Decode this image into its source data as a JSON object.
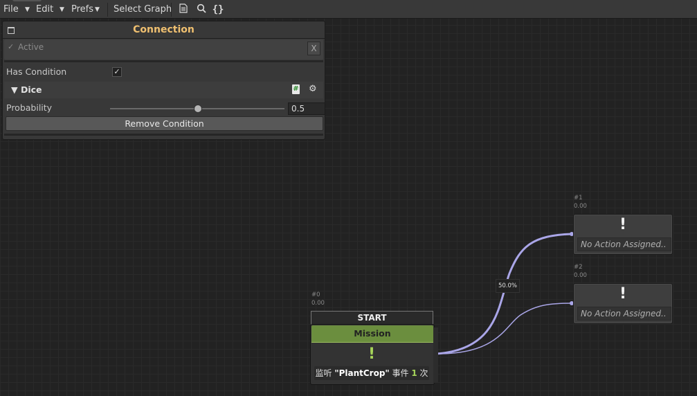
{
  "toolbar": {
    "file": "File",
    "edit": "Edit",
    "prefs": "Prefs",
    "select_graph": "Select Graph",
    "icons": [
      "document-icon",
      "search-icon",
      "braces-icon"
    ]
  },
  "panel": {
    "title": "Connection",
    "active_label": "Active",
    "close_label": "X",
    "has_condition_label": "Has Condition",
    "has_condition_checked": true,
    "condition_title": "Dice",
    "probability_label": "Probability",
    "probability_value": "0.5",
    "probability_fraction": 0.5,
    "remove_button": "Remove Condition"
  },
  "graph": {
    "start_label": "START",
    "start_node": {
      "id": "#0",
      "time": "0.00",
      "title": "Mission",
      "icon": "!",
      "desc_prefix": "监听 ",
      "desc_event": "\"PlantCrop\"",
      "desc_mid": " 事件 ",
      "desc_count": "1",
      "desc_suffix": " 次"
    },
    "action_nodes": [
      {
        "id": "#1",
        "time": "0.00",
        "icon": "!",
        "text": "No Action Assigned.."
      },
      {
        "id": "#2",
        "time": "0.00",
        "icon": "!",
        "text": "No Action Assigned.."
      }
    ],
    "connection_label": "50.0%",
    "colors": {
      "connection": "#aaa6e8",
      "mission_header": "#6b8e3e",
      "accent_title": "#f0c070"
    }
  }
}
